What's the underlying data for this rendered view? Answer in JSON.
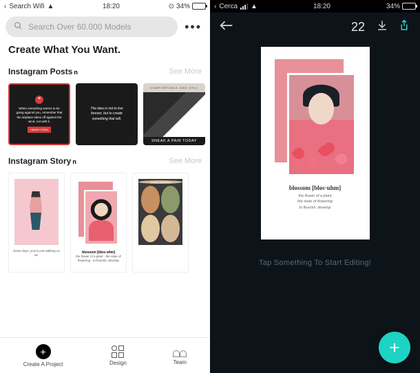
{
  "left": {
    "status": {
      "carrier": "Search Wifi",
      "time": "18:20",
      "battery_pct": "34%",
      "battery_fill": 34
    },
    "search": {
      "placeholder": "Search Over 60.000 Models"
    },
    "headline": "Create What You Want.",
    "sections": [
      {
        "title": "Instagram Posts",
        "badge": "n",
        "see_more": "See More",
        "cards": [
          {
            "icon": "quote-icon",
            "text": "When everything seems to be going against you, remember that the airplane takes off against the wind, not with it.",
            "button": "HENRY FORD"
          },
          {
            "text": "The idea is not to live forever, but to create something that will."
          },
          {
            "top": "COMFORTABLE AND CHIC",
            "band": "SNEAK A PAIR TODAY"
          }
        ]
      },
      {
        "title": "Instagram Story",
        "badge": "n",
        "see_more": "See More",
        "cards": [
          {
            "caption": "Some days, you're just walking on air."
          },
          {
            "title": "blossom [blos·uhm]",
            "caption": "the flower of a plant · the state of flowering · to flourish; develop"
          },
          {
            "top": "today's breakfast"
          }
        ]
      }
    ],
    "nav": {
      "create": "Create A Project",
      "design": "Design",
      "team": "Team"
    }
  },
  "right": {
    "status": {
      "carrier": "Cerca",
      "time": "18:20",
      "battery_pct": "34%",
      "battery_fill": 34
    },
    "header": {
      "count": "22"
    },
    "canvas": {
      "title": "blossom [blos·uhm]",
      "sub1": "the flower of a plant",
      "sub2": "the state of flowering",
      "sub3": "to flourish; develop"
    },
    "hint": "Tap Something To Start Editing!"
  },
  "colors": {
    "accent_red": "#d43c3c",
    "fab": "#1dd4c4",
    "share": "#2ad4d4"
  }
}
